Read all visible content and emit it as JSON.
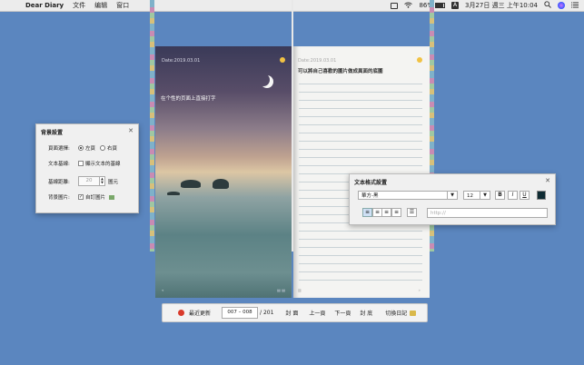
{
  "menubar": {
    "apple_icon": "apple-logo",
    "app_name": "Dear Diary",
    "menus": [
      "文件",
      "编辑",
      "窗口"
    ],
    "battery_percent": "86%",
    "battery_level": 0.86,
    "input_source": "A",
    "clock": "3月27日 週三 上午10:04"
  },
  "left_page": {
    "date": "Date:2019.03.01",
    "text": "在个性的页面上直接打字",
    "footer_left": "«",
    "footer_right": "▤ ▤"
  },
  "right_page": {
    "date": "Date:2019.03.01",
    "text": "可以將自己喜歡的圖片做成異面的底圖",
    "footer_left": "▥",
    "footer_right": "»"
  },
  "toolbar": {
    "recent": "最近更新",
    "page_range": "007 – 008",
    "page_total": "/ 201",
    "cover": "封 面",
    "prev": "上一頁",
    "next": "下一頁",
    "back_cover": "封 底",
    "switch_diary": "切換日記"
  },
  "bg_panel": {
    "title": "背景設置",
    "page_select_label": "頁面選擇:",
    "left_page": "左頁",
    "right_page": "右頁",
    "baseline_label": "文本基線:",
    "baseline_check": "顯示文本的基線",
    "spacing_label": "基線距離:",
    "spacing_value": "20",
    "spacing_unit": "圖元",
    "image_label": "背景圖片:",
    "image_check": "自訂圖片"
  },
  "fmt_panel": {
    "title": "文本格式設置",
    "font": "華方-黑",
    "size": "12",
    "bold": "B",
    "italic": "I",
    "underline": "U",
    "color": "#0f2b33",
    "url_placeholder": "http://"
  }
}
